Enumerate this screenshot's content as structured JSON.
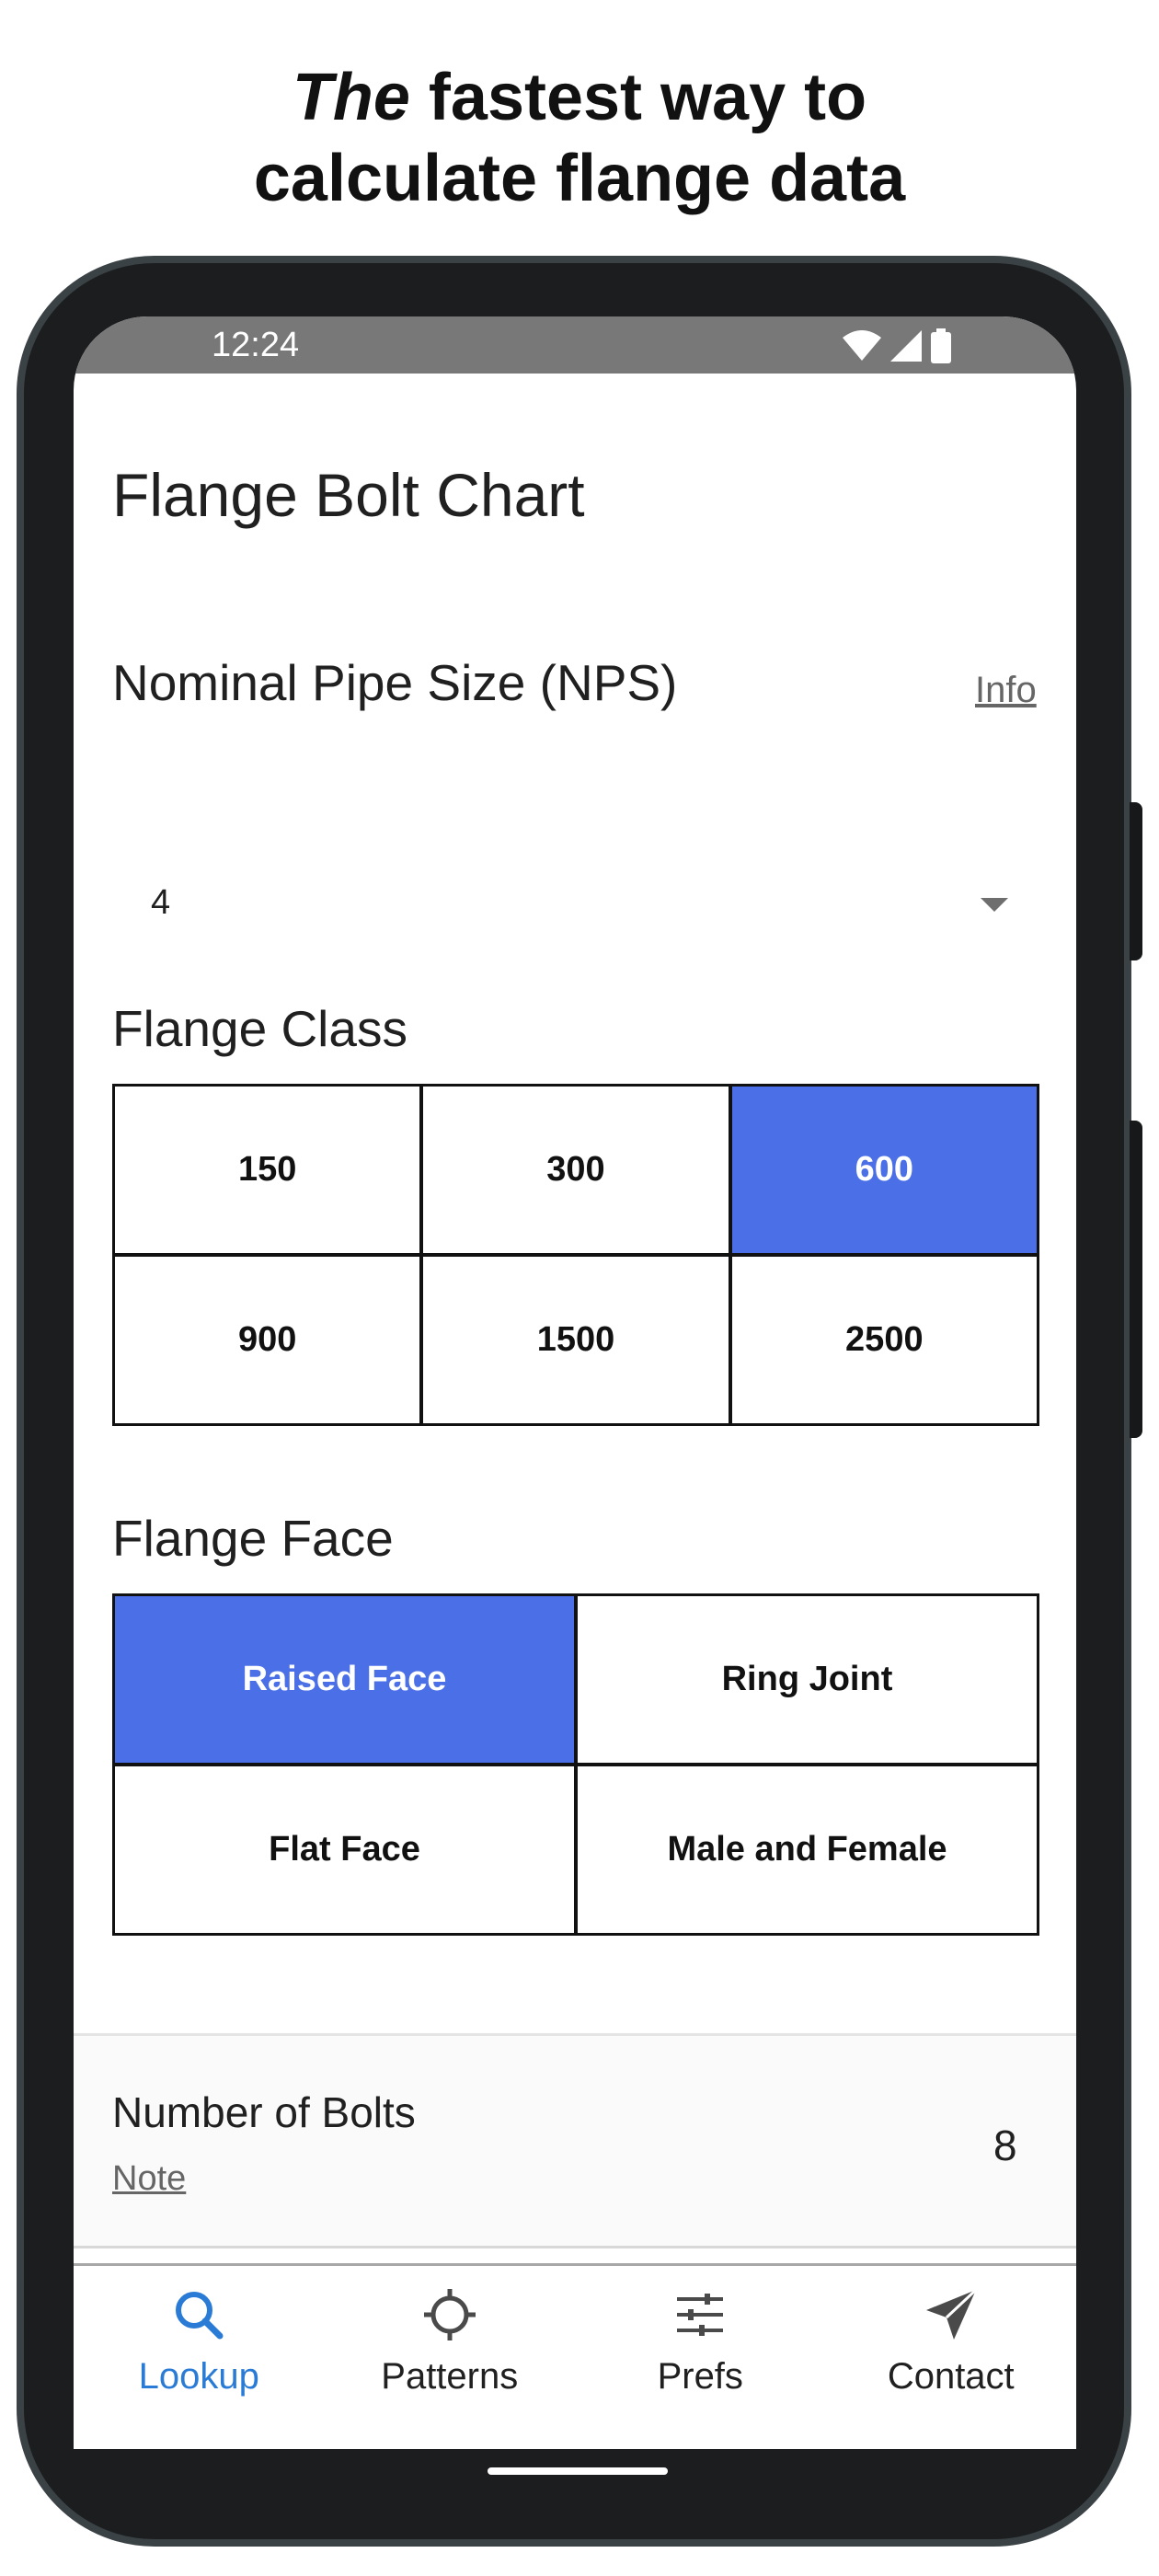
{
  "promo": {
    "headline_italic": "The",
    "headline_rest": " fastest way to",
    "headline_line2": "calculate flange data"
  },
  "status_bar": {
    "time": "12:24",
    "icons": [
      "wifi-icon",
      "signal-icon",
      "battery-icon"
    ]
  },
  "page": {
    "title": "Flange Bolt Chart"
  },
  "nps": {
    "label": "Nominal Pipe Size (NPS)",
    "info_link": "Info",
    "selected_value": "4"
  },
  "flange_class": {
    "label": "Flange Class",
    "options": [
      "150",
      "300",
      "600",
      "900",
      "1500",
      "2500"
    ],
    "selected": "600"
  },
  "flange_face": {
    "label": "Flange Face",
    "options": [
      "Raised Face",
      "Ring Joint",
      "Flat Face",
      "Male and Female"
    ],
    "selected": "Raised Face"
  },
  "result": {
    "bolts_label": "Number of Bolts",
    "note_link": "Note",
    "bolts_value": "8"
  },
  "nav": {
    "items": [
      {
        "label": "Lookup",
        "icon": "search-icon",
        "active": true
      },
      {
        "label": "Patterns",
        "icon": "crosshair-icon",
        "active": false
      },
      {
        "label": "Prefs",
        "icon": "sliders-icon",
        "active": false
      },
      {
        "label": "Contact",
        "icon": "send-icon",
        "active": false
      }
    ]
  },
  "colors": {
    "accent": "#4a6fe6",
    "nav_active": "#2a7bd6",
    "status_bar": "#787878",
    "phone_frame": "#1c1d1f"
  }
}
